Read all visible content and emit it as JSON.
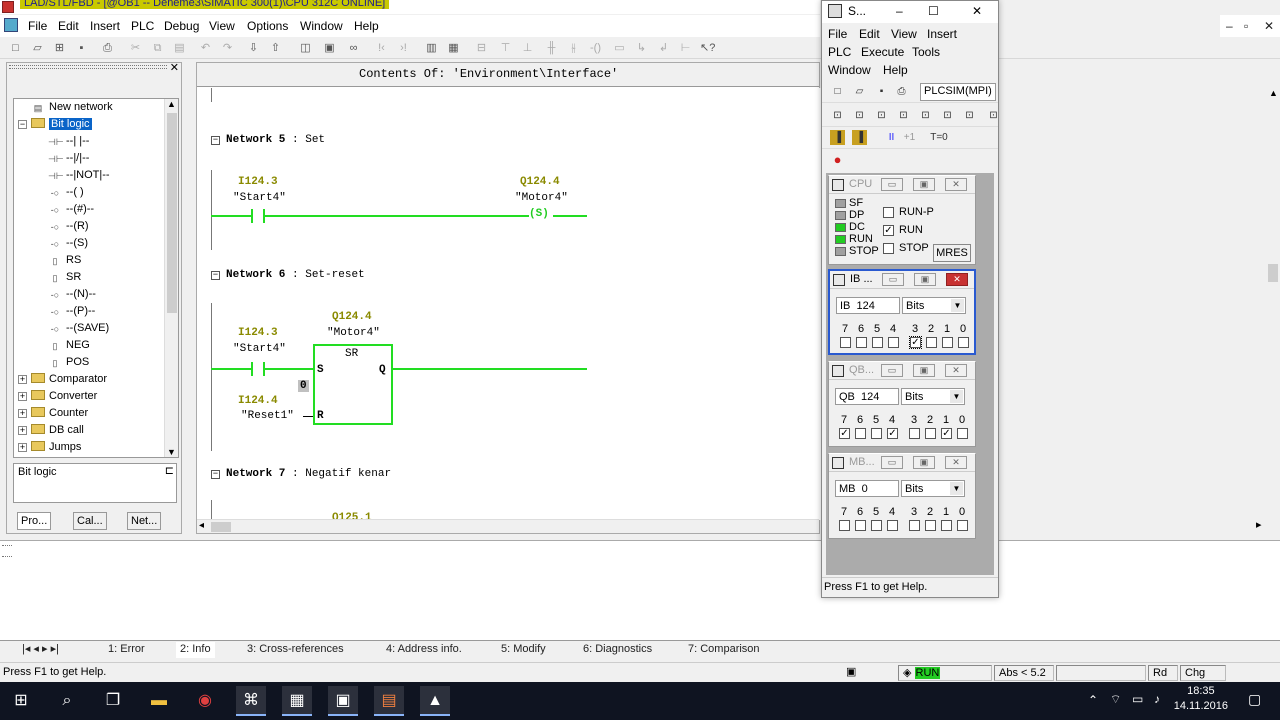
{
  "window": {
    "title": "LAD/STL/FBD  - [@OB1 -- Deneme3\\SIMATIC 300(1)\\CPU 312C  ONLINE]",
    "menu": [
      "File",
      "Edit",
      "Insert",
      "PLC",
      "Debug",
      "View",
      "Options",
      "Window",
      "Help"
    ],
    "controls": {
      "minimize": "–",
      "restore": "▫",
      "close": "✕"
    }
  },
  "catalog": {
    "items": [
      {
        "label": "New network",
        "indent": 1,
        "icon": "new-network-icon"
      },
      {
        "label": "Bit logic",
        "indent": 0,
        "icon": "folder-icon",
        "expanded": true,
        "selected": true
      },
      {
        "label": "--| |--",
        "indent": 2,
        "icon": "contact-icon"
      },
      {
        "label": "--|/|--",
        "indent": 2,
        "icon": "contact-icon"
      },
      {
        "label": "--|NOT|--",
        "indent": 2,
        "icon": "contact-icon"
      },
      {
        "label": "--( )",
        "indent": 2,
        "icon": "coil-icon"
      },
      {
        "label": "--(#)--",
        "indent": 2,
        "icon": "coil-icon"
      },
      {
        "label": "--(R)",
        "indent": 2,
        "icon": "coil-icon"
      },
      {
        "label": "--(S)",
        "indent": 2,
        "icon": "coil-icon"
      },
      {
        "label": "RS",
        "indent": 2,
        "icon": "box-icon"
      },
      {
        "label": "SR",
        "indent": 2,
        "icon": "box-icon"
      },
      {
        "label": "--(N)--",
        "indent": 2,
        "icon": "coil-icon"
      },
      {
        "label": "--(P)--",
        "indent": 2,
        "icon": "coil-icon"
      },
      {
        "label": "--(SAVE)",
        "indent": 2,
        "icon": "coil-icon"
      },
      {
        "label": "NEG",
        "indent": 2,
        "icon": "box-icon"
      },
      {
        "label": "POS",
        "indent": 2,
        "icon": "box-icon"
      },
      {
        "label": "Comparator",
        "indent": 0,
        "icon": "folder-icon"
      },
      {
        "label": "Converter",
        "indent": 0,
        "icon": "folder-icon"
      },
      {
        "label": "Counter",
        "indent": 0,
        "icon": "folder-icon"
      },
      {
        "label": "DB call",
        "indent": 0,
        "icon": "folder-icon"
      },
      {
        "label": "Jumps",
        "indent": 0,
        "icon": "folder-icon"
      }
    ],
    "status_text": "Bit logic",
    "tabs": [
      "Pro...",
      "Cal...",
      "Net..."
    ]
  },
  "editor": {
    "header": "Contents Of: 'Environment\\Interface'",
    "networks": [
      {
        "label": "Network 5",
        "title": "Set"
      },
      {
        "label": "Network 6",
        "title": "Set-reset"
      },
      {
        "label": "Network 7",
        "title": "Negatif kenar"
      }
    ],
    "n5": {
      "in_addr": "I124.3",
      "in_sym": "\"Start4\"",
      "out_addr": "Q124.4",
      "out_sym": "\"Motor4\"",
      "coil": "(S)"
    },
    "n6": {
      "out_addr": "Q124.4",
      "out_sym": "\"Motor4\"",
      "box": "SR",
      "in_addr": "I124.3",
      "in_sym": "\"Start4\"",
      "pin_s": "S",
      "pin_q": "Q",
      "pin_r": "R",
      "r_addr": "I124.4",
      "r_sym": "\"Reset1\"",
      "status_value": "0"
    },
    "n7": {
      "partial": "Q125.1"
    }
  },
  "bottom": {
    "tabs": [
      "1: Error",
      "2: Info",
      "3: Cross-references",
      "4: Address info.",
      "5: Modify",
      "6: Diagnostics",
      "7: Comparison"
    ]
  },
  "status": {
    "help": "Press F1 to get Help.",
    "mode": "RUN",
    "abs": "Abs < 5.2",
    "rd": "Rd",
    "chg": "Chg"
  },
  "plcsim": {
    "title": "S...",
    "menu": [
      "File",
      "Edit",
      "View",
      "Insert",
      "PLC",
      "Execute",
      "Tools",
      "Window",
      "Help"
    ],
    "combo": "PLCSIM(MPI)",
    "tb3": [
      "II",
      "+1",
      "T=0"
    ],
    "cpu": {
      "title": "CPU",
      "leds": [
        {
          "label": "SF",
          "color": "#a0a0a0"
        },
        {
          "label": "DP",
          "color": "#a0a0a0"
        },
        {
          "label": "DC",
          "color": "#22cc22"
        },
        {
          "label": "RUN",
          "color": "#22cc22"
        },
        {
          "label": "STOP",
          "color": "#a0a0a0"
        }
      ],
      "modes": [
        {
          "label": "RUN-P",
          "checked": false
        },
        {
          "label": "RUN",
          "checked": true
        },
        {
          "label": "STOP",
          "checked": false
        }
      ],
      "mres": "MRES"
    },
    "ib": {
      "title": "IB ...",
      "area": "IB",
      "addr": "124",
      "fmt": "Bits",
      "bits": [
        false,
        false,
        false,
        false,
        true,
        false,
        false,
        false
      ]
    },
    "qb": {
      "title": "QB...",
      "area": "QB",
      "addr": "124",
      "fmt": "Bits",
      "bits": [
        true,
        false,
        false,
        true,
        false,
        false,
        true,
        false
      ]
    },
    "mb": {
      "title": "MB...",
      "area": "MB",
      "addr": "0",
      "fmt": "Bits",
      "bits": [
        false,
        false,
        false,
        false,
        false,
        false,
        false,
        false
      ]
    },
    "bit_labels": [
      "7",
      "6",
      "5",
      "4",
      "3",
      "2",
      "1",
      "0"
    ],
    "status": "Press F1 to get Help."
  },
  "taskbar": {
    "time": "18:35",
    "date": "14.11.2016"
  }
}
